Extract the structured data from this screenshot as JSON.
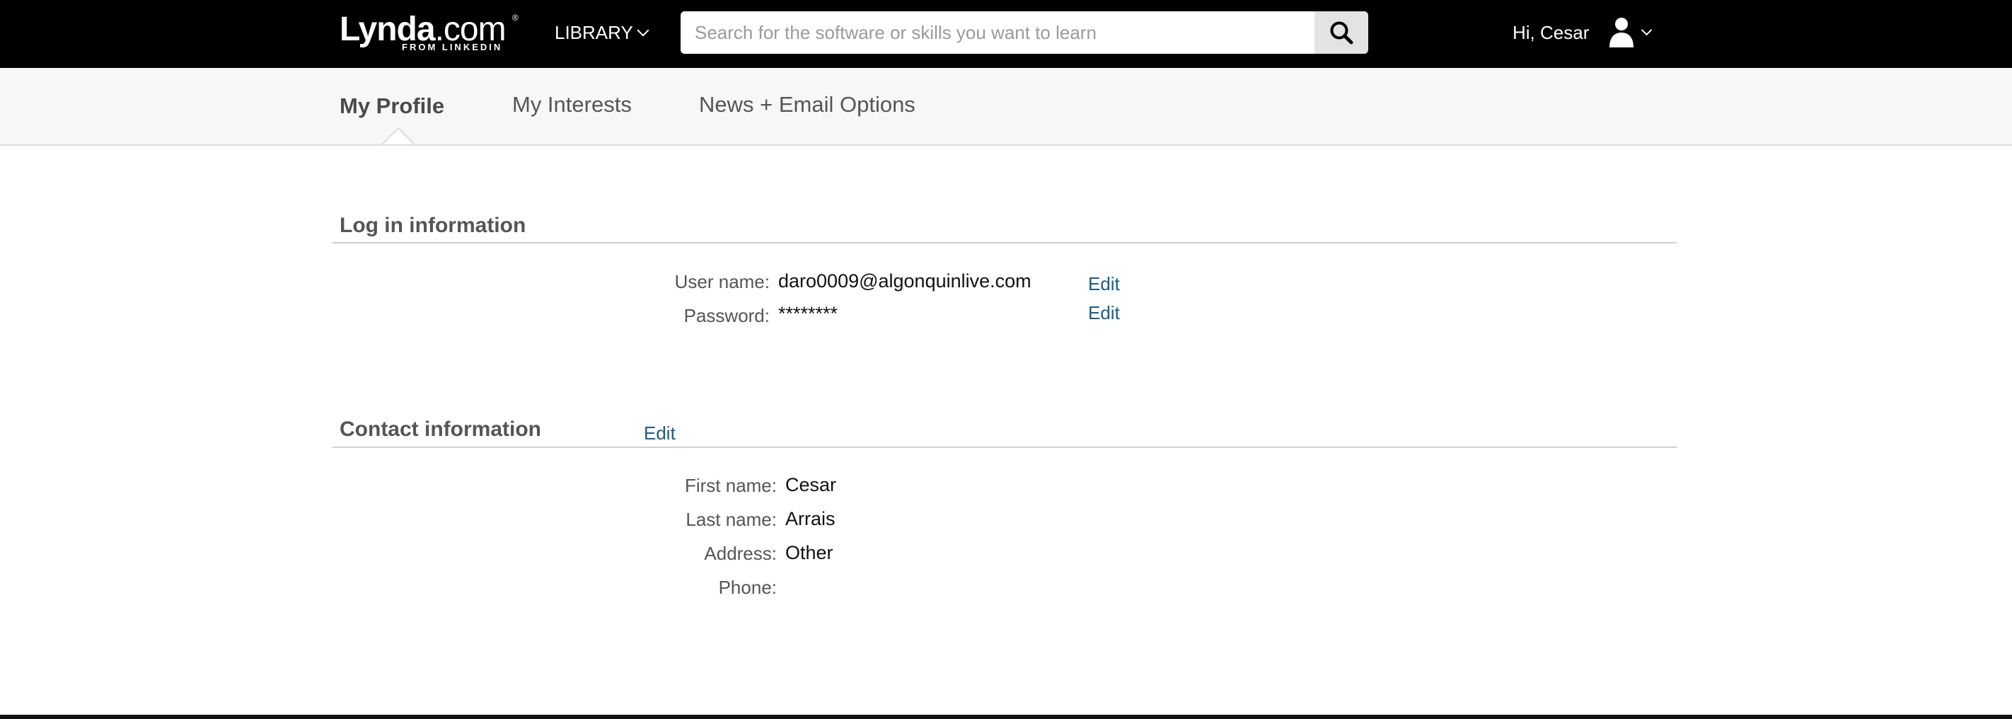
{
  "header": {
    "logo_text": "Lynda",
    "logo_suffix": ".com",
    "logo_registered": "®",
    "logo_sub": "FROM LINKEDIN",
    "library_label": "LIBRARY",
    "search_placeholder": "Search for the software or skills you want to learn",
    "search_value": "",
    "greeting": "Hi, Cesar",
    "icons": [
      "chevron-down-icon",
      "search-icon",
      "user-icon"
    ]
  },
  "tabs": [
    {
      "label": "My Profile",
      "active": true
    },
    {
      "label": "My Interests",
      "active": false
    },
    {
      "label": "News + Email Options",
      "active": false
    }
  ],
  "login_section": {
    "title": "Log in information",
    "fields": [
      {
        "label": "User name:",
        "value": "daro0009@algonquinlive.com",
        "edit": "Edit"
      },
      {
        "label": "Password:",
        "value": "********",
        "edit": "Edit"
      }
    ]
  },
  "contact_section": {
    "title": "Contact information",
    "edit": "Edit",
    "fields": [
      {
        "label": "First name:",
        "value": "Cesar"
      },
      {
        "label": "Last name:",
        "value": "Arrais"
      },
      {
        "label": "Address:",
        "value": "Other"
      },
      {
        "label": "Phone:",
        "value": ""
      }
    ]
  },
  "colors": {
    "topbar": "#000000",
    "subnav_bg": "#f7f7f7",
    "link": "#1a5c8a"
  }
}
